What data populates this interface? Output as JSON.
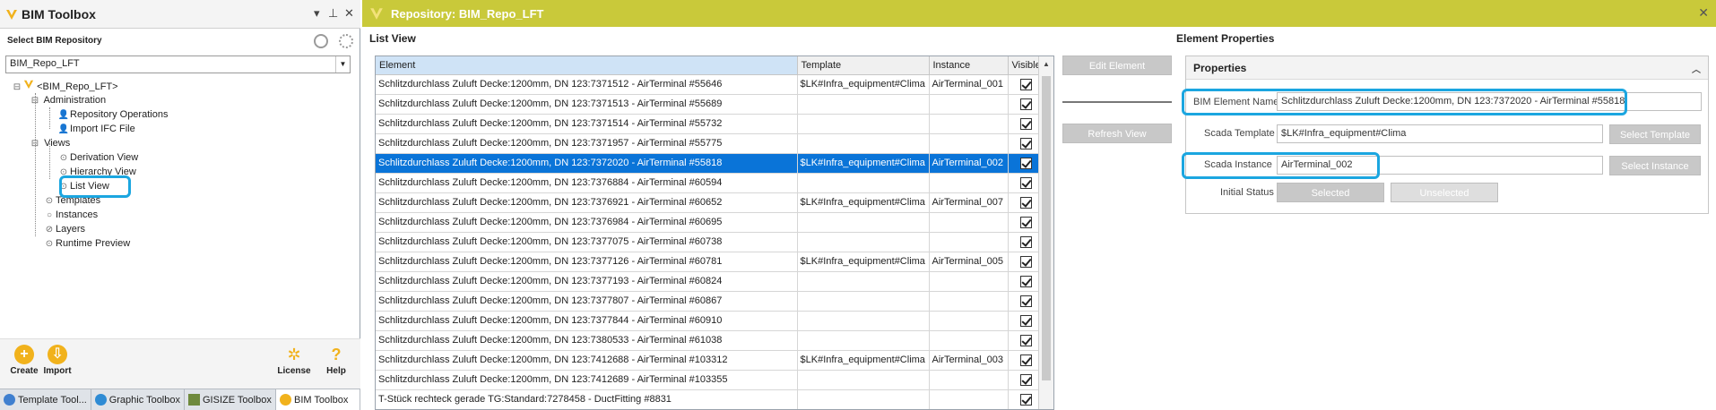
{
  "toolbox": {
    "title": "BIM Toolbox",
    "select_label": "Select BIM Repository",
    "repository_value": "BIM_Repo_LFT",
    "tree": {
      "root": "<BIM_Repo_LFT>",
      "administration": "Administration",
      "repo_ops": "Repository Operations",
      "import_ifc": "Import IFC File",
      "views": "Views",
      "derivation": "Derivation View",
      "hierarchy": "Hierarchy View",
      "list_view": "List View",
      "templates": "Templates",
      "instances": "Instances",
      "layers": "Layers",
      "runtime": "Runtime Preview"
    },
    "footer": {
      "create": "Create",
      "import": "Import",
      "license": "License",
      "help": "Help"
    },
    "tabs": [
      "Template Tool...",
      "Graphic Toolbox",
      "GISIZE Toolbox",
      "BIM Toolbox"
    ]
  },
  "window": {
    "title": "Repository: BIM_Repo_LFT",
    "list_view_label": "List View",
    "columns": {
      "element": "Element",
      "template": "Template",
      "instance": "Instance",
      "visible": "Visible"
    },
    "rows": [
      {
        "element": "Schlitzdurchlass Zuluft Decke:1200mm, DN 123:7371512 - AirTerminal #55646",
        "template": "$LK#Infra_equipment#Clima",
        "instance": "AirTerminal_001"
      },
      {
        "element": "Schlitzdurchlass Zuluft Decke:1200mm, DN 123:7371513 - AirTerminal #55689",
        "template": "",
        "instance": ""
      },
      {
        "element": "Schlitzdurchlass Zuluft Decke:1200mm, DN 123:7371514 - AirTerminal #55732",
        "template": "",
        "instance": ""
      },
      {
        "element": "Schlitzdurchlass Zuluft Decke:1200mm, DN 123:7371957 - AirTerminal #55775",
        "template": "",
        "instance": ""
      },
      {
        "element": "Schlitzdurchlass Zuluft Decke:1200mm, DN 123:7372020 - AirTerminal #55818",
        "template": "$LK#Infra_equipment#Clima",
        "instance": "AirTerminal_002"
      },
      {
        "element": "Schlitzdurchlass Zuluft Decke:1200mm, DN 123:7376884 - AirTerminal #60594",
        "template": "",
        "instance": ""
      },
      {
        "element": "Schlitzdurchlass Zuluft Decke:1200mm, DN 123:7376921 - AirTerminal #60652",
        "template": "$LK#Infra_equipment#Clima",
        "instance": "AirTerminal_007"
      },
      {
        "element": "Schlitzdurchlass Zuluft Decke:1200mm, DN 123:7376984 - AirTerminal #60695",
        "template": "",
        "instance": ""
      },
      {
        "element": "Schlitzdurchlass Zuluft Decke:1200mm, DN 123:7377075 - AirTerminal #60738",
        "template": "",
        "instance": ""
      },
      {
        "element": "Schlitzdurchlass Zuluft Decke:1200mm, DN 123:7377126 - AirTerminal #60781",
        "template": "$LK#Infra_equipment#Clima",
        "instance": "AirTerminal_005"
      },
      {
        "element": "Schlitzdurchlass Zuluft Decke:1200mm, DN 123:7377193 - AirTerminal #60824",
        "template": "",
        "instance": ""
      },
      {
        "element": "Schlitzdurchlass Zuluft Decke:1200mm, DN 123:7377807 - AirTerminal #60867",
        "template": "",
        "instance": ""
      },
      {
        "element": "Schlitzdurchlass Zuluft Decke:1200mm, DN 123:7377844 - AirTerminal #60910",
        "template": "",
        "instance": ""
      },
      {
        "element": "Schlitzdurchlass Zuluft Decke:1200mm, DN 123:7380533 - AirTerminal #61038",
        "template": "",
        "instance": ""
      },
      {
        "element": "Schlitzdurchlass Zuluft Decke:1200mm, DN 123:7412688 - AirTerminal #103312",
        "template": "$LK#Infra_equipment#Clima",
        "instance": "AirTerminal_003"
      },
      {
        "element": "Schlitzdurchlass Zuluft Decke:1200mm, DN 123:7412689 - AirTerminal #103355",
        "template": "",
        "instance": ""
      },
      {
        "element": "T-Stück rechteck gerade TG:Standard:7278458 - DuctFitting #8831",
        "template": "",
        "instance": ""
      }
    ],
    "selected_row_index": 4,
    "buttons": {
      "edit_element": "Edit Element",
      "refresh_view": "Refresh View"
    }
  },
  "properties": {
    "section_label": "Element Properties",
    "group_title": "Properties",
    "bim_element_name_label": "BIM Element Name",
    "bim_element_name_value": "Schlitzdurchlass Zuluft Decke:1200mm, DN 123:7372020 - AirTerminal #55818",
    "scada_template_label": "Scada Template",
    "scada_template_value": "$LK#Infra_equipment#Clima",
    "select_template": "Select Template",
    "scada_instance_label": "Scada Instance",
    "scada_instance_value": "AirTerminal_002",
    "select_instance": "Select Instance",
    "initial_status_label": "Initial Status",
    "selected": "Selected",
    "unselected": "Unselected"
  },
  "colors": {
    "title_bar": "#c9c93a",
    "selection": "#0a74d8",
    "callout": "#1ba6e0",
    "accent_orange": "#f1b21c"
  }
}
